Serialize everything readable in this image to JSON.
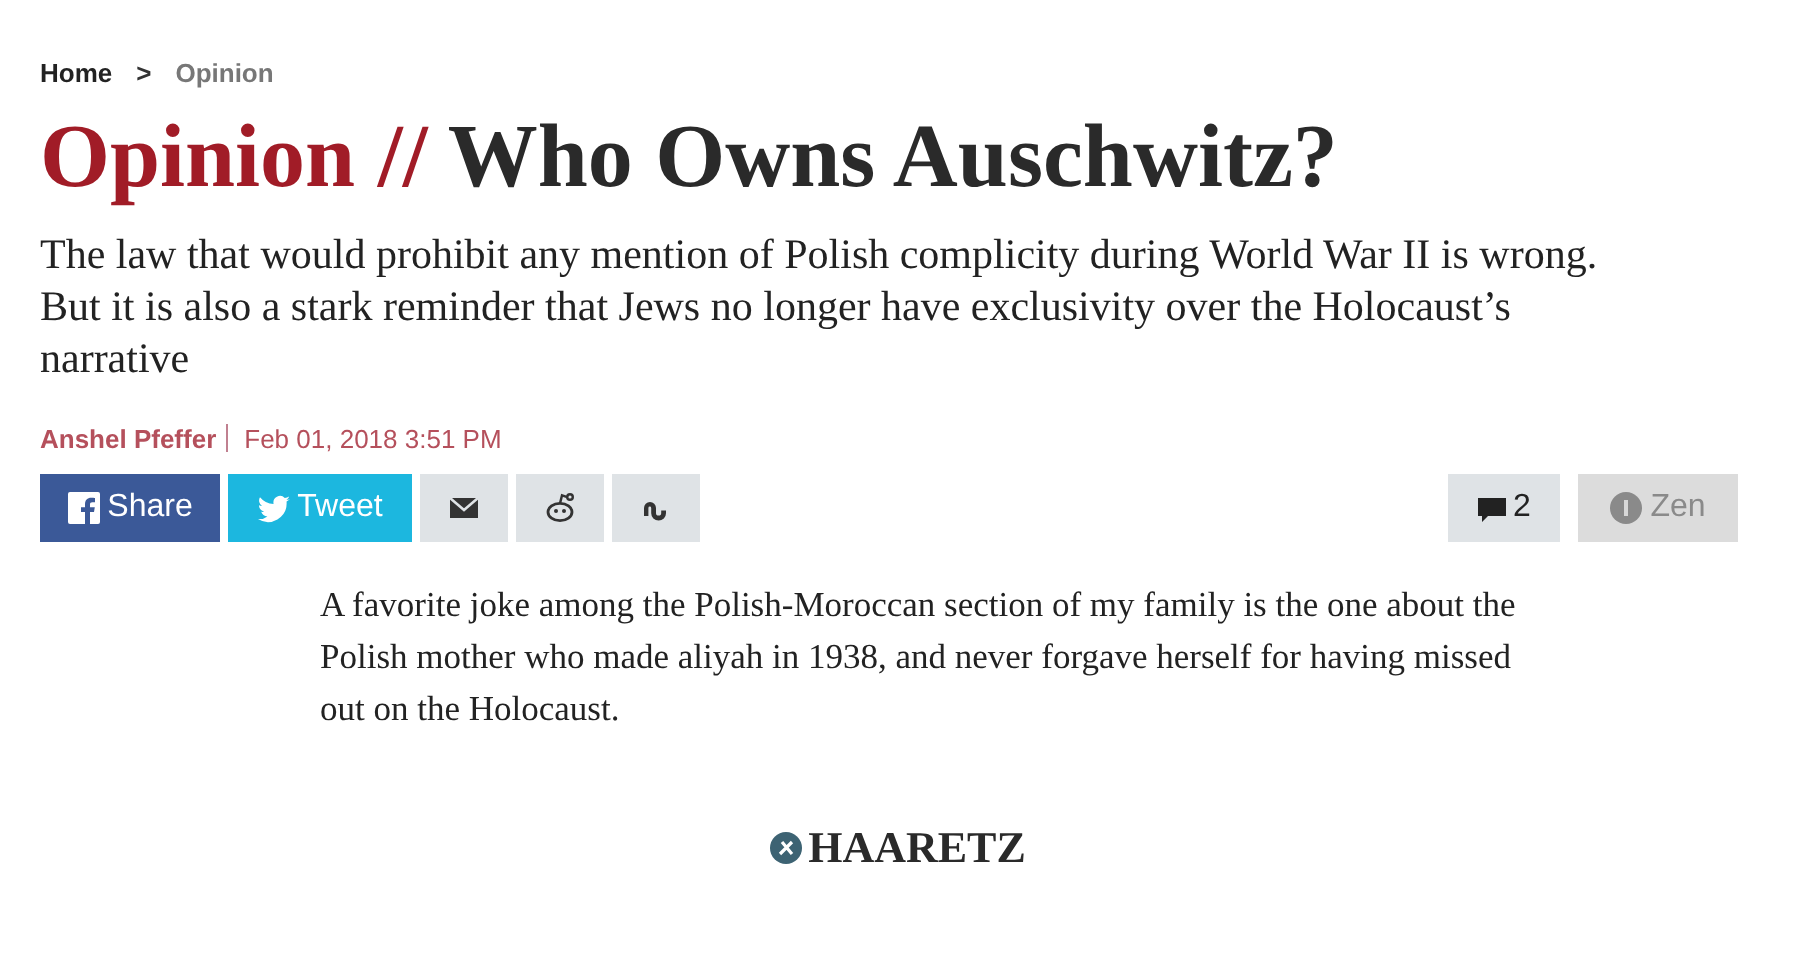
{
  "breadcrumb": [
    {
      "label": "Home"
    },
    {
      "label": ">"
    },
    {
      "label": "Opinion"
    }
  ],
  "headline": {
    "section": "Opinion //",
    "title": "Who Owns Auschwitz?"
  },
  "subtitle": "The law that would prohibit any mention of Polish complicity during World War II is wrong. But it is also a stark reminder that Jews no longer have exclusivity over the Holocaust’s narrative",
  "byline": {
    "author": "Anshel Pfeffer",
    "date": "Feb 01, 2018 3:51 PM"
  },
  "share_buttons": [
    {
      "kind": "facebook",
      "label": "Share"
    },
    {
      "kind": "twitter",
      "label": "Tweet"
    },
    {
      "kind": "email"
    },
    {
      "kind": "reddit"
    },
    {
      "kind": "stumbleupon"
    }
  ],
  "comments": {
    "count": "2"
  },
  "zen": {
    "label": "Zen",
    "disabled": true
  },
  "body": "A favorite joke among the Polish-Moroccan section of my family is the one about the Polish mother who made aliyah in 1938, and never forgave herself for having missed out on the Holocaust.",
  "logo": {
    "text": "HAARETZ"
  }
}
